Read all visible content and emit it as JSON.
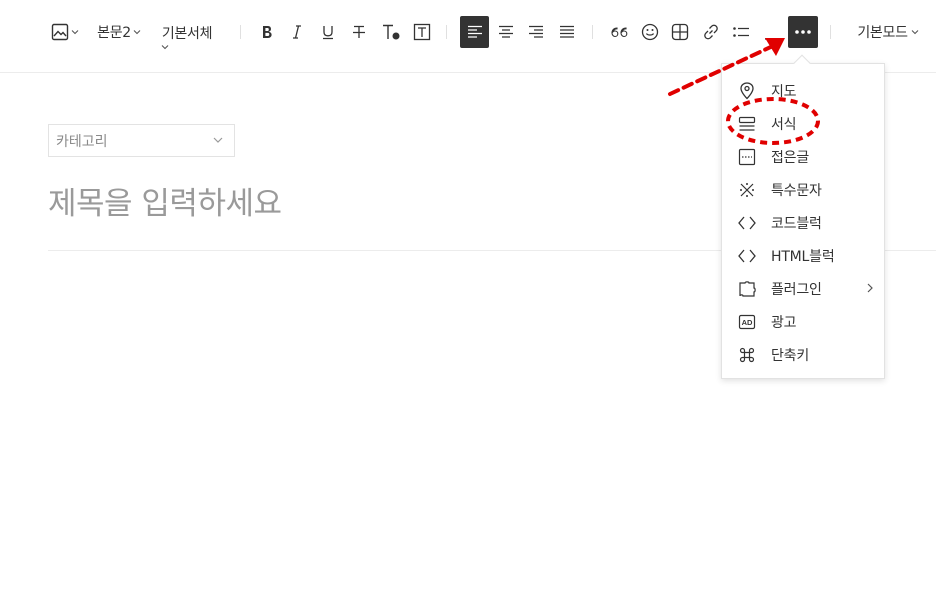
{
  "toolbar": {
    "image_icon": "image-icon",
    "paragraph_style": "본문2",
    "font_family": "기본서체",
    "mode_label": "기본모드",
    "more_icon": "more-icon"
  },
  "editor": {
    "category_placeholder": "카테고리",
    "title_placeholder": "제목을 입력하세요"
  },
  "more_menu": {
    "items": [
      {
        "label": "지도",
        "icon": "map-pin-icon"
      },
      {
        "label": "서식",
        "icon": "template-icon"
      },
      {
        "label": "접은글",
        "icon": "fold-icon"
      },
      {
        "label": "특수문자",
        "icon": "special-char-icon"
      },
      {
        "label": "코드블럭",
        "icon": "code-icon"
      },
      {
        "label": "HTML블럭",
        "icon": "html-icon"
      },
      {
        "label": "플러그인",
        "icon": "plugin-icon"
      },
      {
        "label": "광고",
        "icon": "ad-icon"
      },
      {
        "label": "단축키",
        "icon": "command-icon"
      }
    ]
  },
  "colors": {
    "accent_dark": "#333333",
    "annotation_red": "#e00000"
  }
}
